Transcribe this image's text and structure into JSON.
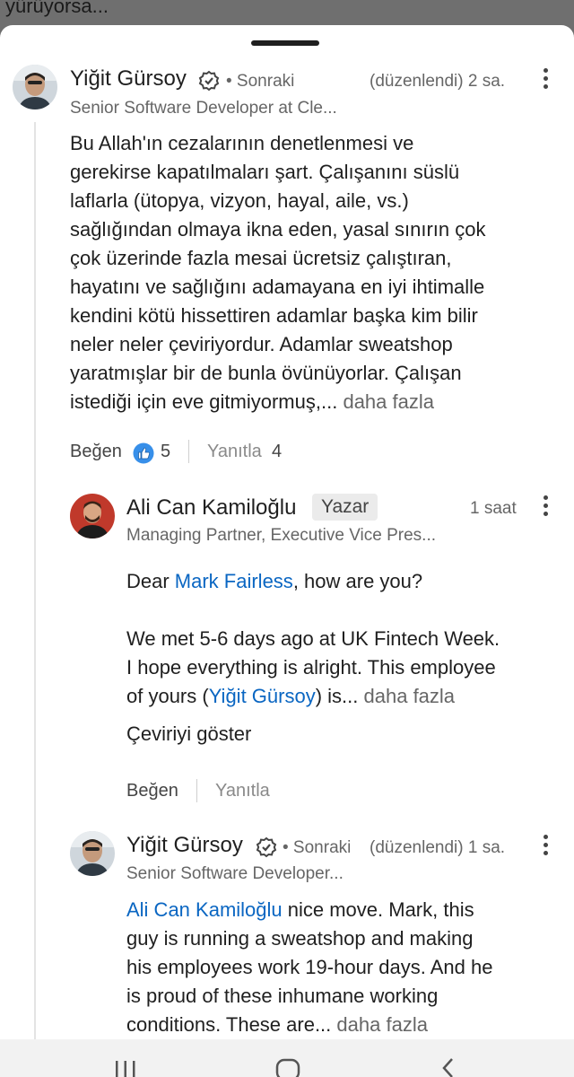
{
  "background_text": "yürüyorsa...",
  "comment1": {
    "author": "Yiğit Gürsoy",
    "follow": "• Sonraki",
    "edited_time": "(düzenlendi) 2 sa.",
    "headline": "Senior Software Developer at Cle...",
    "body_lines": [
      "Bu Allah'ın cezalarının denetlenmesi ve",
      "gerekirse kapatılmaları şart. Çalışanını süslü",
      "laflarla (ütopya, vizyon, hayal, aile, vs.)",
      "sağlığından olmaya ikna eden, yasal sınırın çok",
      "çok üzerinde fazla mesai ücretsiz çalıştıran,",
      "hayatını ve sağlığını adamayana en iyi ihtimalle",
      "kendini kötü hissettiren adamlar başka kim bilir",
      "neler neler çeviriyordur. Adamlar sweatshop",
      "yaratmışlar bir de bunla övünüyorlar. Çalışan"
    ],
    "body_last_line": "istediği için eve gitmiyormuş,...",
    "more": "daha fazla",
    "like_label": "Beğen",
    "like_count": "5",
    "reply_label": "Yanıtla",
    "reply_count": "4"
  },
  "reply1": {
    "author": "Ali Can Kamiloğlu",
    "badge": "Yazar",
    "time": "1 saat",
    "headline": "Managing Partner, Executive Vice Pres...",
    "greeting_prefix": "Dear ",
    "greeting_mention": "Mark Fairless",
    "greeting_suffix": ", how are you?",
    "para_lines": [
      "We met 5-6 days ago at UK Fintech Week.",
      "I hope everything is alright. This employee"
    ],
    "last_prefix": "of yours (",
    "last_mention": "Yiğit Gürsoy",
    "last_suffix": ") is...",
    "more": "daha fazla",
    "translate": "Çeviriyi göster",
    "like_label": "Beğen",
    "reply_label": "Yanıtla"
  },
  "reply2": {
    "author": "Yiğit Gürsoy",
    "follow": "• Sonraki",
    "edited_time": "(düzenlendi) 1 sa.",
    "headline": "Senior Software Developer...",
    "mention": "Ali Can Kamiloğlu",
    "first_suffix": " nice move. Mark, this",
    "lines": [
      "guy is running a sweatshop and making",
      "his employees work 19-hour days. And he",
      "is proud of these inhumane working"
    ],
    "last_line": "conditions. These are...",
    "more": "daha fazla"
  },
  "colors": {
    "link": "#0a66c2",
    "muted": "#666666",
    "like_blue": "#378fe9"
  },
  "icons": [
    "verified-icon",
    "kebab-menu-icon",
    "like-reaction-icon",
    "recent-apps-icon",
    "home-icon",
    "back-icon"
  ]
}
